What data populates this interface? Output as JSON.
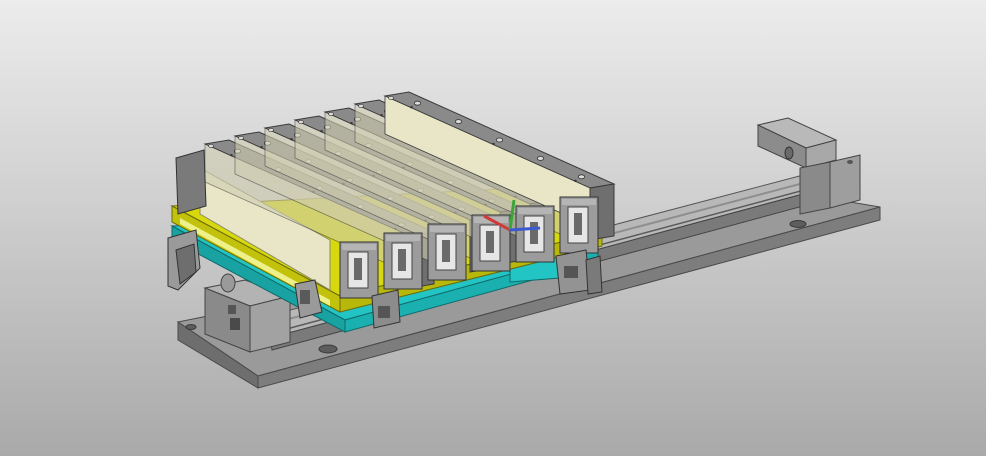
{
  "viewport": {
    "background_top": "#ececec",
    "background_bottom": "#a9a9a9"
  },
  "model": {
    "description_icon": "cad-assembly-3d",
    "colors": {
      "steel_top": "#8a8a8a",
      "steel_side": "#6f6f6f",
      "steel_dark": "#555555",
      "yellow_plate": "#d8d80e",
      "yellow_light": "#eef08a",
      "cyan_plate": "#22c4c4",
      "cream_panel": "#e8e6c6",
      "rail_light": "#b8b8b8",
      "rail_dark": "#7a7a7a"
    },
    "top_blocks": 7,
    "bolt_columns": 5,
    "front_cylinders": 6
  },
  "triad": {
    "x_color": "#d23a3a",
    "y_color": "#3aa63a",
    "z_color": "#3a5ad2"
  }
}
